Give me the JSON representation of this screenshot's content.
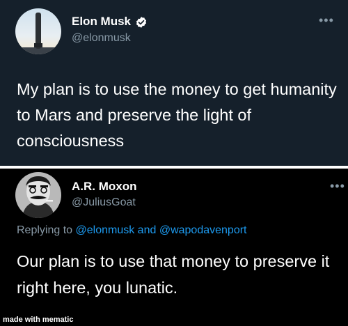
{
  "colors": {
    "top_background": "#15202b",
    "bottom_background": "#000000",
    "primary_text": "#ffffff",
    "secondary_text": "#8899a6",
    "link": "#1d9bf0",
    "verified_badge": "#ffffff"
  },
  "tweet": {
    "display_name": "Elon Musk",
    "handle": "@elonmusk",
    "verified_icon": "verified-badge-icon",
    "menu_icon": "more-options-icon",
    "text": "My plan is to use the money to get humanity to Mars and preserve the light of consciousness"
  },
  "reply": {
    "display_name": "A.R. Moxon",
    "handle": "@JuliusGoat",
    "menu_icon": "more-options-icon",
    "replying_prefix": "Replying to",
    "replying_to_1": "@elonmusk",
    "replying_joiner": "and",
    "replying_to_2": "@wapodavenport",
    "text": "Our plan is to use that money to preserve it right here, you lunatic."
  },
  "watermark": {
    "text": "made with mematic"
  }
}
